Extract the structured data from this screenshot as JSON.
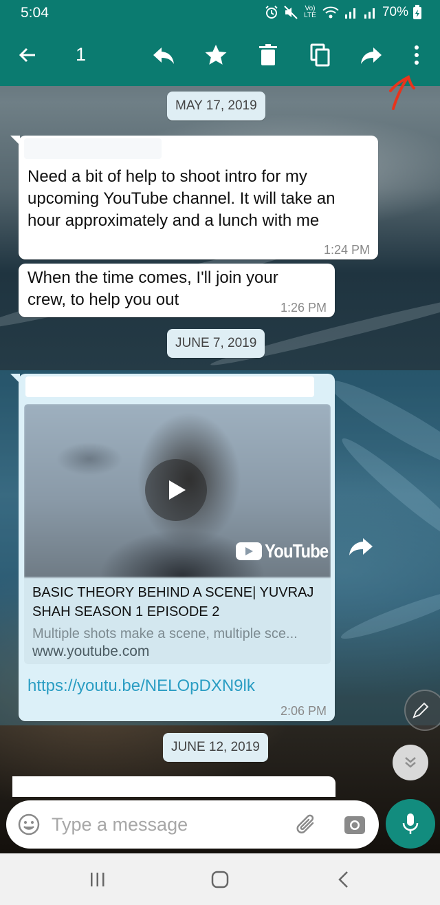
{
  "status_bar": {
    "time": "5:04",
    "battery": "70%",
    "volte": "Vo) LTE",
    "icons": [
      "alarm-icon",
      "mute-icon",
      "volte-icon",
      "wifi-icon",
      "signal-icon",
      "signal-icon",
      "battery-icon"
    ]
  },
  "toolbar": {
    "selected_count": "1",
    "actions": [
      "back-arrow-icon",
      "reply-icon",
      "star-icon",
      "delete-icon",
      "copy-icon",
      "forward-icon",
      "more-vert-icon"
    ],
    "color": "#0b7b70"
  },
  "messages": [
    {
      "type": "date",
      "label": "MAY 17, 2019"
    },
    {
      "type": "text",
      "text": "Need a bit of help to shoot intro for my upcoming YouTube channel. It will take an hour approximately and a lunch with me",
      "time": "1:24 PM"
    },
    {
      "type": "text",
      "text": "When the time comes, I'll join your crew, to help you out",
      "time": "1:26 PM"
    },
    {
      "type": "date",
      "label": "JUNE 7, 2019"
    },
    {
      "type": "link",
      "preview_title": "BASIC THEORY BEHIND A SCENE| YUVRAJ SHAH SEASON 1 EPISODE 2",
      "preview_desc": "Multiple shots make a scene, multiple sce...",
      "preview_domain": "www.youtube.com",
      "preview_brand": "YouTube",
      "url": "https://youtu.be/NELOpDXN9lk",
      "time": "2:06 PM",
      "selected": true
    },
    {
      "type": "date",
      "label": "JUNE 12, 2019"
    }
  ],
  "composer": {
    "placeholder": "Type a message",
    "value": ""
  },
  "colors": {
    "accent": "#128c7e",
    "selection": "#34b7f1",
    "annotation": "#e8341c"
  }
}
